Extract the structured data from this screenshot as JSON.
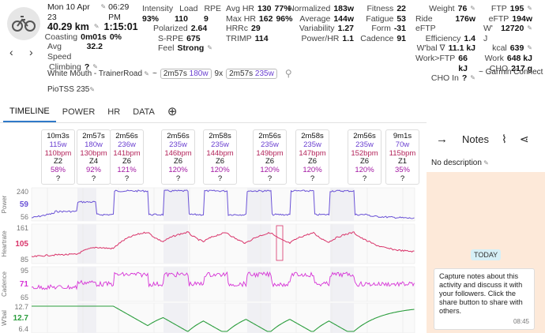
{
  "header": {
    "date": "Mon 10 Apr 23",
    "time": "06:29 PM",
    "distance": "40.29 km",
    "duration": "1:15:01",
    "coasting_label": "Coasting",
    "coasting_value": "0m01s",
    "coasting_pct": "0%",
    "avg_speed_label": "Avg Speed",
    "avg_speed_value": "32.2",
    "climbing_label": "Climbing",
    "climbing_value": "?"
  },
  "metrics1": {
    "intensity_label": "Intensity",
    "intensity_value": "93%",
    "load_label": "Load",
    "load_value": "110",
    "rpe_label": "RPE",
    "rpe_value": "9",
    "polarized_label": "Polarized",
    "polarized_value": "2.64",
    "srpe_label": "S-RPE",
    "srpe_value": "675",
    "feel_label": "Feel",
    "feel_value": "Strong"
  },
  "metrics2": {
    "avghr_label": "Avg HR",
    "avghr_value": "130",
    "avghr_pct": "77%",
    "maxhr_label": "Max HR",
    "maxhr_value": "162",
    "maxhr_pct": "96%",
    "hrrc_label": "HRRc",
    "hrrc_value": "29",
    "trimp_label": "TRIMP",
    "trimp_value": "114"
  },
  "metrics3": {
    "normalized_label": "Normalized",
    "normalized_value": "183w",
    "average_label": "Average",
    "average_value": "144w",
    "variability_label": "Variability",
    "variability_value": "1.27",
    "powerhr_label": "Power/HR",
    "powerhr_value": "1.1"
  },
  "metrics4": {
    "fitness_label": "Fitness",
    "fitness_value": "22",
    "fatigue_label": "Fatigue",
    "fatigue_value": "53",
    "form_label": "Form",
    "form_value": "-31",
    "cadence_label": "Cadence",
    "cadence_value": "91"
  },
  "metrics5": {
    "weight_label": "Weight",
    "weight_value": "76",
    "rideeftp_label": "Ride eFTP",
    "rideeftp_value": "176w",
    "efficiency_label": "Efficiency",
    "efficiency_value": "1.4",
    "wbal_label": "W'bal ∇",
    "wbal_value": "11.1 kJ",
    "workftp_label": "Work>FTP",
    "workftp_value": "66 kJ",
    "choin_label": "CHO In",
    "choin_value": "?"
  },
  "metrics6": {
    "ftp_label": "FTP",
    "ftp_value": "195",
    "eftp_label": "eFTP",
    "eftp_value": "194w",
    "wj_label": "W' J",
    "wj_value": "12720",
    "kcal_label": "kcal",
    "kcal_value": "639",
    "work_label": "Work",
    "work_value": "648 kJ",
    "cho_label": "CHO",
    "cho_value": "217 g"
  },
  "subline": {
    "name": "White Mouth - TrainerRoad",
    "tilde": "~",
    "chip1_time": "2m57s",
    "chip1_power": "180w",
    "repeat": "9x",
    "chip2_time": "2m57s",
    "chip2_power": "235w",
    "source": "~ Garmin Connect",
    "piotss_label": "PioTSS",
    "piotss_value": "235"
  },
  "tabs": [
    "TIMELINE",
    "POWER",
    "HR",
    "DATA"
  ],
  "intervals": [
    {
      "dur": "10m3s",
      "w": "115w",
      "bpm": "110bpm",
      "zone": "Z2",
      "pct": "58%",
      "q": "?"
    },
    {
      "dur": "2m57s",
      "w": "180w",
      "bpm": "130bpm",
      "zone": "Z4",
      "pct": "92%",
      "q": "?"
    },
    {
      "dur": "2m56s",
      "w": "236w",
      "bpm": "141bpm",
      "zone": "Z6",
      "pct": "121%",
      "q": "?"
    },
    {
      "dur": "2m56s",
      "w": "235w",
      "bpm": "146bpm",
      "zone": "Z6",
      "pct": "120%",
      "q": "?"
    },
    {
      "dur": "2m58s",
      "w": "235w",
      "bpm": "144bpm",
      "zone": "Z6",
      "pct": "120%",
      "q": "?"
    },
    {
      "dur": "2m56s",
      "w": "235w",
      "bpm": "149bpm",
      "zone": "Z6",
      "pct": "120%",
      "q": "?"
    },
    {
      "dur": "2m58s",
      "w": "235w",
      "bpm": "147bpm",
      "zone": "Z6",
      "pct": "120%",
      "q": "?"
    },
    {
      "dur": "2m56s",
      "w": "235w",
      "bpm": "152bpm",
      "zone": "Z6",
      "pct": "120%",
      "q": "?"
    },
    {
      "dur": "9m1s",
      "w": "70w",
      "bpm": "115bpm",
      "zone": "Z1",
      "pct": "35%",
      "q": "?"
    }
  ],
  "charts": {
    "power": {
      "label": "Power",
      "ticks": [
        "240",
        "59",
        "56"
      ],
      "color": "#6a52d6"
    },
    "hr": {
      "label": "Heartrate",
      "ticks": [
        "161",
        "105",
        "85"
      ],
      "color": "#d9346a"
    },
    "cadence": {
      "label": "Cadence",
      "ticks": [
        "95",
        "71",
        "65"
      ],
      "color": "#d633d6"
    },
    "wbal": {
      "label": "W'bal",
      "ticks": [
        "12.7",
        "12.7",
        "6.4"
      ],
      "color": "#2a9d3c"
    }
  },
  "notes": {
    "title": "Notes",
    "description": "No description",
    "today": "TODAY",
    "message": "Capture notes about this activity and discuss it with your followers. Click the share button to share with others.",
    "time": "08:45"
  },
  "colors": {
    "accent": "#2f79c9",
    "power": "#6a52d6",
    "hr": "#d9346a",
    "cadence": "#d633d6",
    "wbal": "#2a9d3c"
  }
}
